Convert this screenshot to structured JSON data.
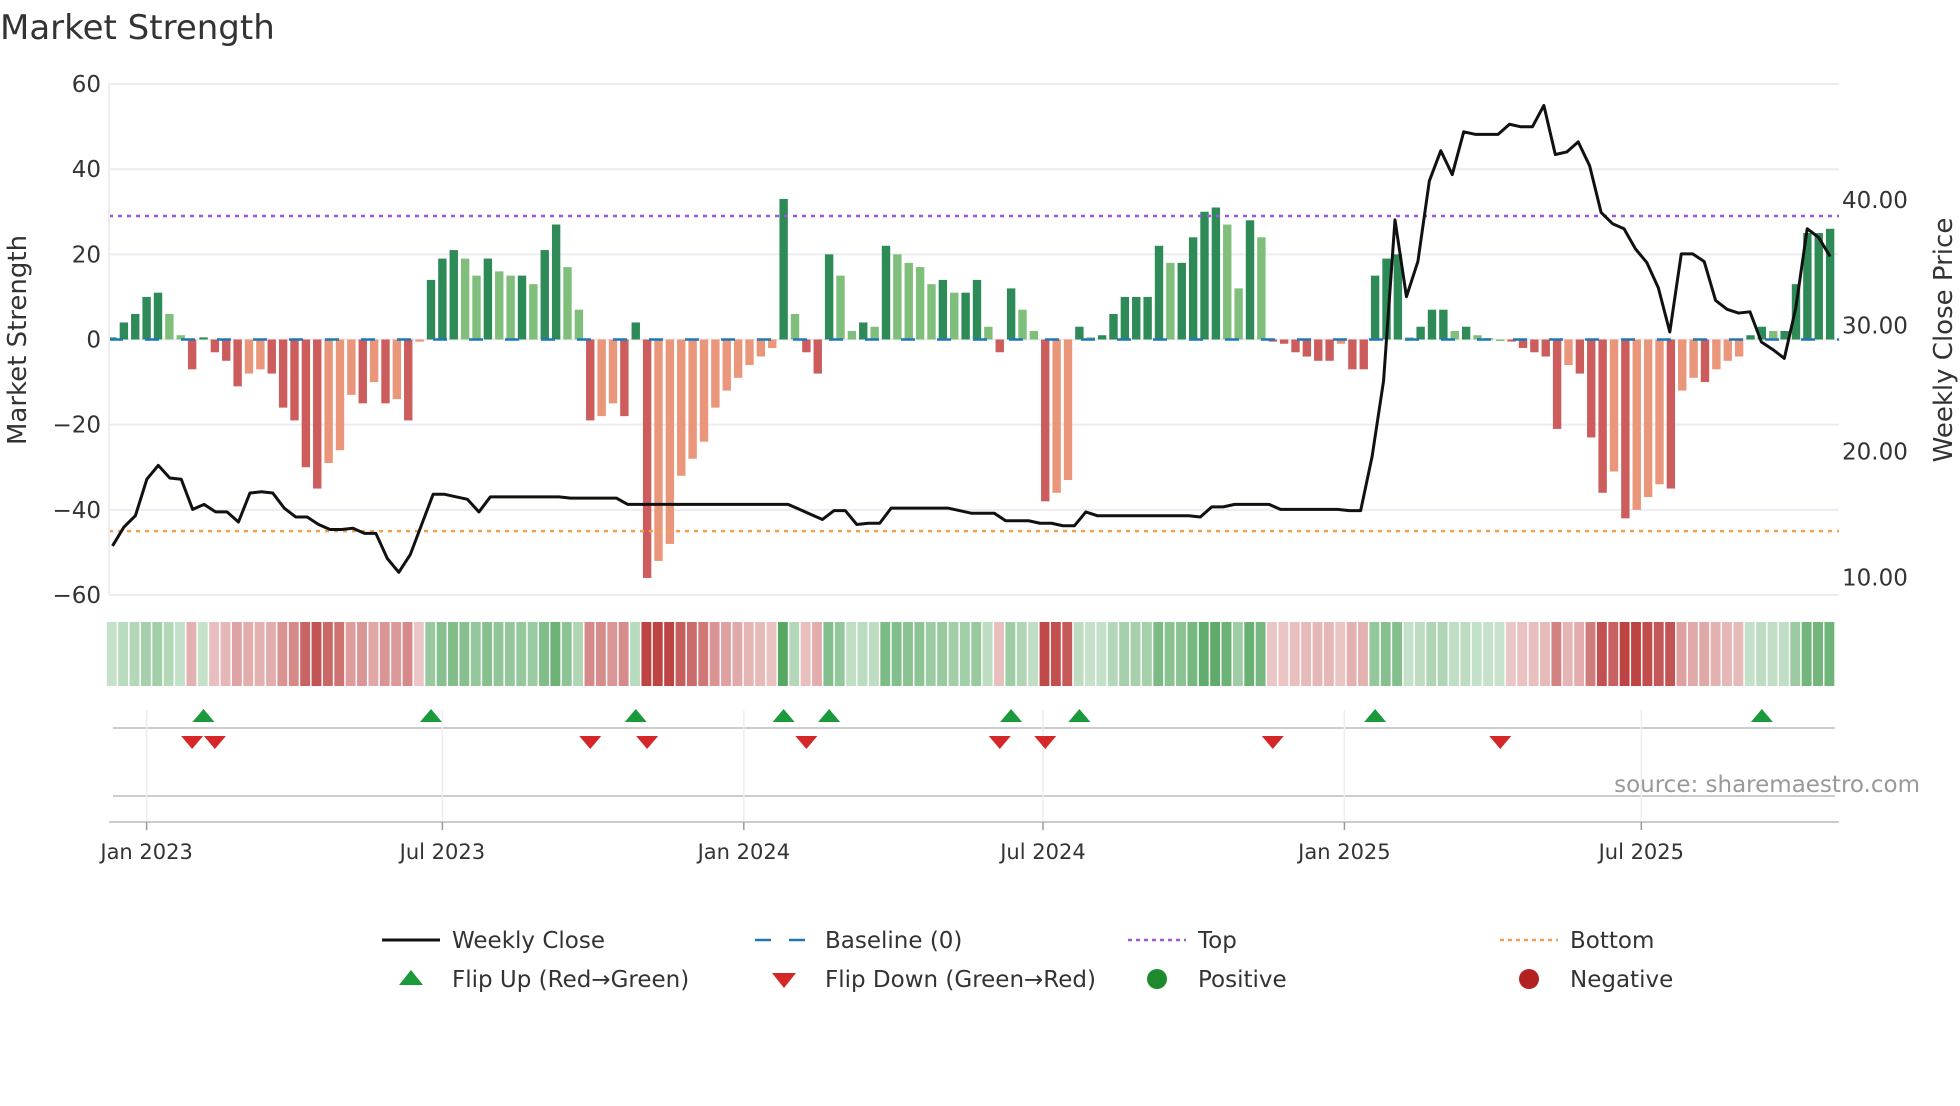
{
  "chart_data": {
    "type": "bar",
    "title": "Market Strength",
    "ylabel": "Market Strength",
    "y2label": "Weekly Close Price",
    "ylim": [
      -60,
      60
    ],
    "y2lim": [
      8.6,
      49.2
    ],
    "yticks": [
      60,
      40,
      20,
      0,
      -20,
      -40,
      -60
    ],
    "yticklabels": [
      "60",
      "40",
      "20",
      "0",
      "−20",
      "−40",
      "−60"
    ],
    "y2ticks": [
      10,
      20,
      30,
      40
    ],
    "y2ticklabels": [
      "10.00",
      "20.00",
      "30.00",
      "40.00"
    ],
    "x_unit": "week index",
    "xticks": [
      {
        "week": 3,
        "label": "Jan 2023"
      },
      {
        "week": 29,
        "label": "Jul 2023"
      },
      {
        "week": 55.5,
        "label": "Jan 2024"
      },
      {
        "week": 81.8,
        "label": "Jul 2024"
      },
      {
        "week": 108.3,
        "label": "Jan 2025"
      },
      {
        "week": 134.4,
        "label": "Jul 2025"
      }
    ],
    "top_level": 29,
    "bottom_level": -45,
    "baseline": 0,
    "strength": [
      0.5,
      4,
      6,
      10,
      11,
      6,
      1,
      -7,
      0.5,
      -3,
      -5,
      -11,
      -8,
      -7,
      -8,
      -16,
      -19,
      -30,
      -35,
      -29,
      -26,
      -13,
      -15,
      -10,
      -15,
      -14,
      -19,
      -0.5,
      14,
      19,
      21,
      19,
      15,
      19,
      16,
      15,
      15,
      13,
      21,
      27,
      17,
      7,
      -19,
      -18,
      -15,
      -18,
      4,
      -56,
      -52,
      -48,
      -32,
      -28,
      -24,
      -16,
      -12,
      -9,
      -6,
      -4,
      -2,
      33,
      6,
      -3,
      -8,
      20,
      15,
      2,
      4,
      3,
      22,
      20,
      18,
      17,
      13,
      14,
      11,
      11,
      14,
      3,
      -3,
      12,
      7,
      2,
      -38,
      -36,
      -33,
      3,
      0.5,
      1,
      6,
      10,
      10,
      10,
      22,
      18,
      18,
      24,
      30,
      31,
      27,
      12,
      28,
      24,
      -0.5,
      -1,
      -3,
      -4,
      -5,
      -5,
      -1,
      -7,
      -7,
      15,
      19,
      20,
      0.5,
      3,
      7,
      7,
      2,
      3,
      1,
      0.3,
      0,
      -0.5,
      -2,
      -3,
      -4,
      -21,
      -6,
      -8,
      -23,
      -36,
      -31,
      -42,
      -40,
      -37,
      -34,
      -35,
      -12,
      -9,
      -10,
      -7,
      -5,
      -4,
      1,
      3,
      2,
      2,
      13,
      25,
      25,
      26
    ],
    "close": [
      12.5,
      14,
      14.9,
      17.8,
      18.9,
      17.9,
      17.8,
      15.4,
      15.8,
      15.2,
      15.2,
      14.4,
      16.7,
      16.8,
      16.7,
      15.5,
      14.8,
      14.8,
      14.2,
      13.8,
      13.8,
      13.9,
      13.5,
      13.5,
      11.5,
      10.4,
      11.8,
      14.2,
      16.6,
      16.6,
      16.4,
      16.2,
      15.2,
      16.4,
      16.4,
      16.4,
      16.4,
      16.4,
      16.4,
      16.4,
      16.3,
      16.3,
      16.3,
      16.3,
      16.3,
      15.8,
      15.8,
      15.8,
      15.8,
      15.8,
      15.8,
      15.8,
      15.8,
      15.8,
      15.8,
      15.8,
      15.8,
      15.8,
      15.8,
      15.8,
      15.4,
      15.0,
      14.6,
      15.3,
      15.3,
      14.2,
      14.3,
      14.3,
      15.5,
      15.5,
      15.5,
      15.5,
      15.5,
      15.5,
      15.3,
      15.1,
      15.1,
      15.1,
      14.5,
      14.5,
      14.5,
      14.3,
      14.3,
      14.1,
      14.1,
      15.2,
      14.9,
      14.9,
      14.9,
      14.9,
      14.9,
      14.9,
      14.9,
      14.9,
      14.9,
      14.8,
      15.6,
      15.6,
      15.8,
      15.8,
      15.8,
      15.8,
      15.4,
      15.4,
      15.4,
      15.4,
      15.4,
      15.4,
      15.3,
      15.3,
      19.6,
      25.6,
      38.4,
      32.3,
      35.1,
      41.5,
      43.9,
      42,
      45.4,
      45.2,
      45.2,
      45.2,
      46,
      45.8,
      45.8,
      47.5,
      43.6,
      43.8,
      44.6,
      42.7,
      39,
      38.1,
      37.7,
      36.1,
      35,
      33,
      29.5,
      35.7,
      35.7,
      35.1,
      32,
      31.3,
      31,
      31.1,
      28.7,
      28.1,
      27.4,
      31.4,
      37.7,
      37,
      35.5
    ],
    "flip_up_weeks": [
      8,
      28,
      46,
      59,
      63,
      79,
      85,
      111,
      145
    ],
    "flip_down_weeks": [
      7,
      9,
      42,
      47,
      61,
      78,
      82,
      102,
      122
    ],
    "legend": {
      "placement": "bottom",
      "items": [
        {
          "key": "close",
          "label": "Weekly Close"
        },
        {
          "key": "baseline",
          "label": "Baseline (0)"
        },
        {
          "key": "top",
          "label": "Top"
        },
        {
          "key": "bottom",
          "label": "Bottom"
        },
        {
          "key": "flip_up",
          "label": "Flip Up (Red→Green)"
        },
        {
          "key": "flip_down",
          "label": "Flip Down (Green→Red)"
        },
        {
          "key": "positive",
          "label": "Positive"
        },
        {
          "key": "negative",
          "label": "Negative"
        }
      ]
    },
    "colors": {
      "pos_strong": "#2e8b57",
      "pos_weak": "#7fbf7b",
      "neg_strong": "#cd5c5c",
      "neg_weak": "#e9967a",
      "close": "#111111",
      "baseline": "#1f77b4",
      "top": "#9b59d6",
      "bottom": "#f0a050",
      "flip_up": "#1a9a3a",
      "flip_down": "#d62728",
      "positive": "#1e8a2e",
      "negative": "#b22222"
    },
    "source": "source: sharemaestro.com"
  }
}
